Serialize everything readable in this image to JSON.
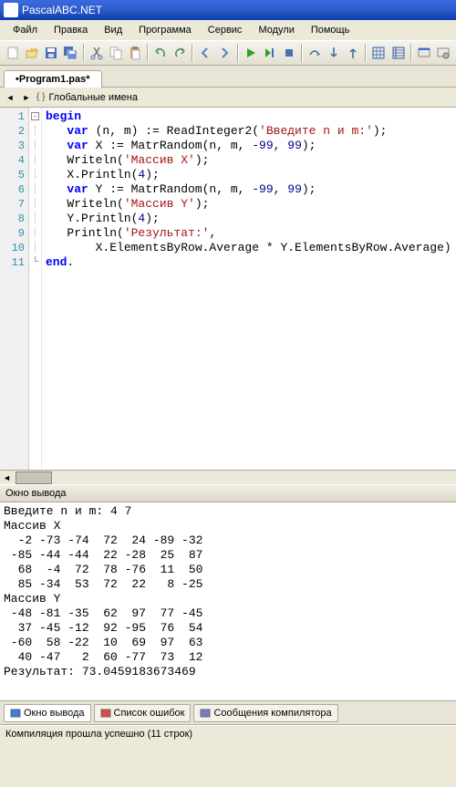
{
  "app_title": "PascalABC.NET",
  "menu": [
    "Файл",
    "Правка",
    "Вид",
    "Программа",
    "Сервис",
    "Модули",
    "Помощь"
  ],
  "tab_name": "•Program1.pas*",
  "nav_label": "Глобальные имена",
  "code_lines": [
    {
      "n": 1,
      "fold": "-",
      "html": "<span class=\"kw\">begin</span>"
    },
    {
      "n": 2,
      "fold": "",
      "html": "   <span class=\"kw\">var</span> (n, m) := ReadInteger2(<span class=\"str\">'Введите n и m:'</span>);"
    },
    {
      "n": 3,
      "fold": "",
      "html": "   <span class=\"kw\">var</span> X := MatrRandom(n, m, <span class=\"num\">-99</span>, <span class=\"num\">99</span>);"
    },
    {
      "n": 4,
      "fold": "",
      "html": "   Writeln(<span class=\"str\">'Массив X'</span>);"
    },
    {
      "n": 5,
      "fold": "",
      "html": "   X.Println(<span class=\"num\">4</span>);"
    },
    {
      "n": 6,
      "fold": "",
      "html": "   <span class=\"kw\">var</span> Y := MatrRandom(n, m, <span class=\"num\">-99</span>, <span class=\"num\">99</span>);"
    },
    {
      "n": 7,
      "fold": "",
      "html": "   Writeln(<span class=\"str\">'Массив Y'</span>);"
    },
    {
      "n": 8,
      "fold": "",
      "html": "   Y.Println(<span class=\"num\">4</span>);"
    },
    {
      "n": 9,
      "fold": "",
      "html": "   Println(<span class=\"str\">'Результат:'</span>,"
    },
    {
      "n": 10,
      "fold": "",
      "html": "       X.ElementsByRow.Average * Y.ElementsByRow.Average)"
    },
    {
      "n": 11,
      "fold": "L",
      "html": "<span class=\"kw\">end</span>."
    }
  ],
  "output_title": "Окно вывода",
  "output_text": "Введите n и m: 4 7\nМассив X\n  -2 -73 -74  72  24 -89 -32\n -85 -44 -44  22 -28  25  87\n  68  -4  72  78 -76  11  50\n  85 -34  53  72  22   8 -25\nМассив Y\n -48 -81 -35  62  97  77 -45\n  37 -45 -12  92 -95  76  54\n -60  58 -22  10  69  97  63\n  40 -47   2  60 -77  73  12\nРезультат: 73.0459183673469",
  "bottom_tabs": [
    {
      "id": "output",
      "label": "Окно вывода",
      "active": true,
      "color": "#3a7fd5"
    },
    {
      "id": "errors",
      "label": "Список ошибок",
      "active": false,
      "color": "#d94a4a"
    },
    {
      "id": "compiler",
      "label": "Сообщения компилятора",
      "active": false,
      "color": "#7a7ac0"
    }
  ],
  "status_text": "Компиляция прошла успешно (11 строк)",
  "icons": {
    "new": "#f8f8e0",
    "open": "#e6c76a",
    "save": "#4a6fbd",
    "saveall": "#4a6fbd",
    "cut": "#888",
    "copy": "#d8a85a",
    "paste": "#d8a85a",
    "undo": "#4a8a4a",
    "redo": "#4a8a4a",
    "nav1": "#5a7fbf",
    "nav2": "#5a7fbf",
    "run": "#2aa52a",
    "stop": "#4a6fbd",
    "pause": "#4a6fbd",
    "stepover": "#3a6a9f",
    "stepinto": "#3a6a9f",
    "stepout": "#3a6a9f",
    "grid": "#2a5fab",
    "seq": "#2a5fab",
    "ex1": "#888",
    "ex2": "#888"
  }
}
